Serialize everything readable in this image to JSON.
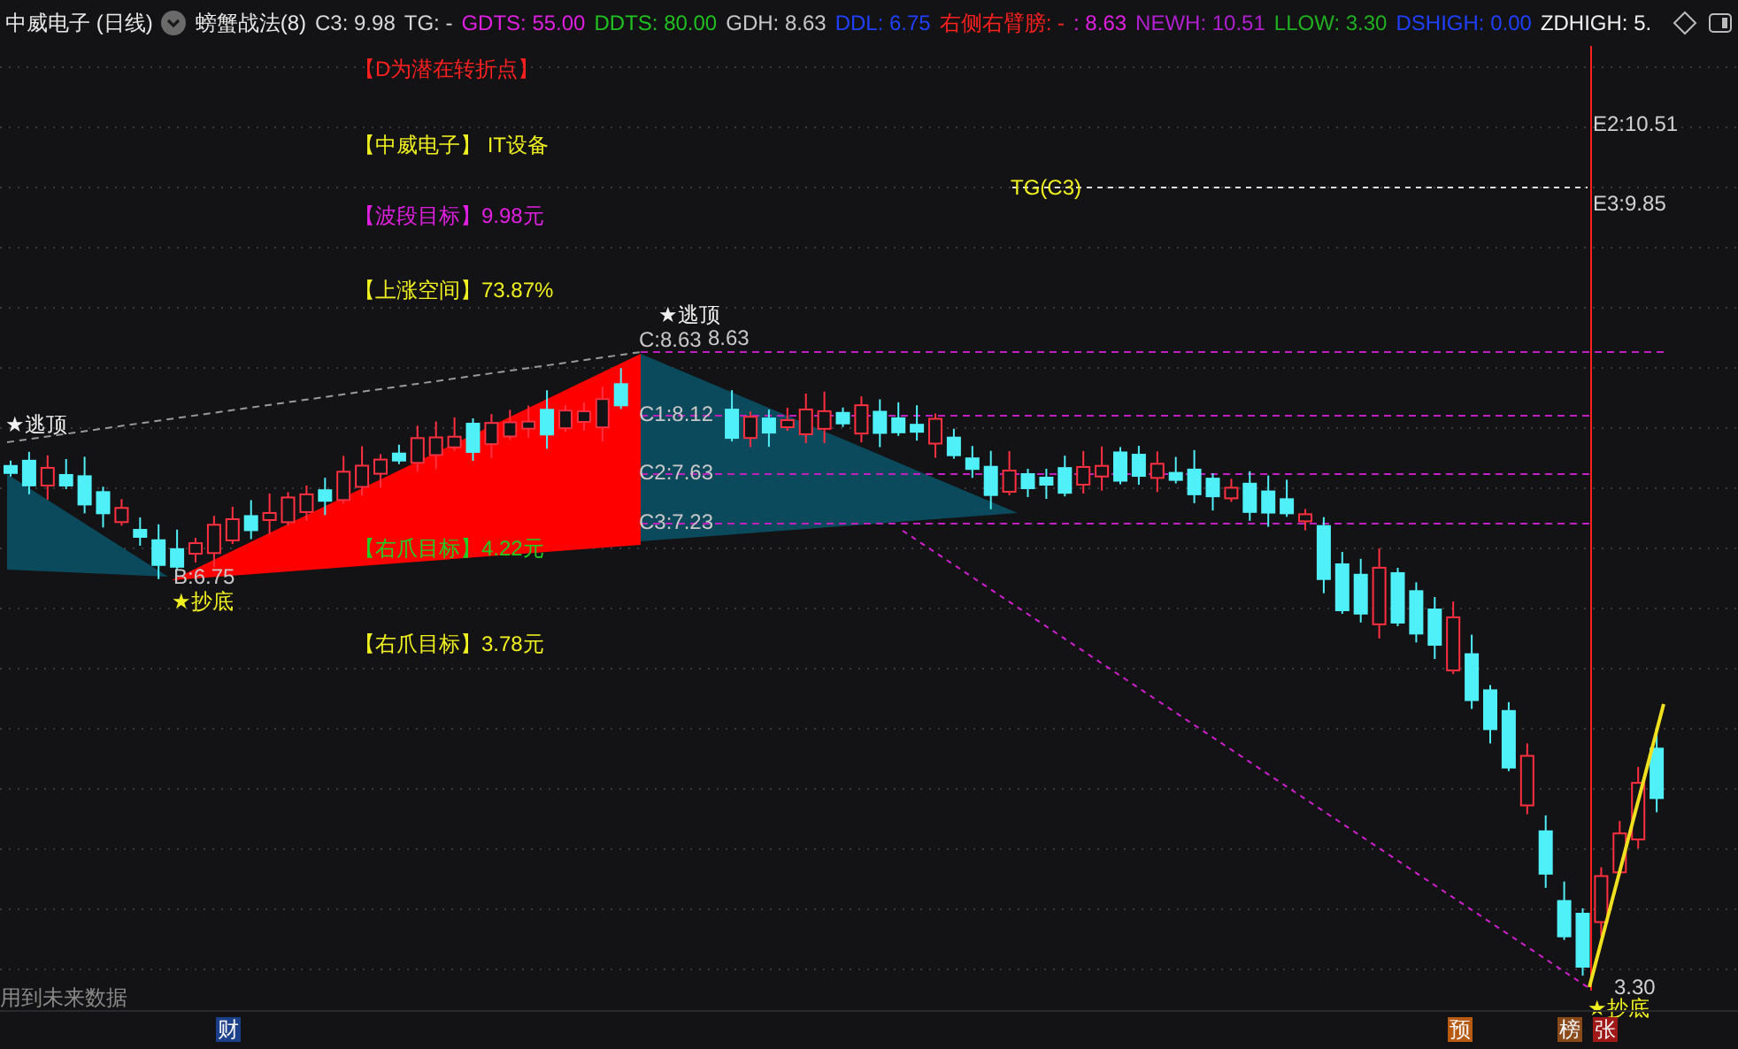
{
  "header": {
    "title": "中威电子 (日线)",
    "indicator": "螃蟹战法(8)",
    "values": [
      {
        "text": "C3: 9.98",
        "color": "#d8d8d8"
      },
      {
        "text": "TG: -",
        "color": "#d8d8d8"
      },
      {
        "text": "GDTS: 55.00",
        "color": "#e020e0"
      },
      {
        "text": "DDTS: 80.00",
        "color": "#20c020"
      },
      {
        "text": "GDH: 8.63",
        "color": "#c8c8c8"
      },
      {
        "text": "DDL: 6.75",
        "color": "#2040ff"
      },
      {
        "text": "右侧右臂膀: -",
        "color": "#ff2020"
      },
      {
        "text": ": 8.63",
        "color": "#e020e0"
      },
      {
        "text": "NEWH: 10.51",
        "color": "#b020d0"
      },
      {
        "text": "LLOW: 3.30",
        "color": "#20b020"
      },
      {
        "text": "DSHIGH: 0.00",
        "color": "#2040ff"
      },
      {
        "text": "ZDHIGH: 5.",
        "color": "#f0f0f0"
      }
    ]
  },
  "chart": {
    "labels": [
      {
        "text": "【D为潜在转折点】",
        "color": "#ff2020"
      },
      {
        "text": "【中威电子】 IT设备",
        "color": "#f0f020"
      },
      {
        "text": "【波段目标】9.98元",
        "color": "#e020e0"
      },
      {
        "text": "【上涨空间】73.87%",
        "color": "#f0f020"
      },
      {
        "text": "TG(C3)",
        "color": "#f0f020"
      },
      {
        "text": "★逃顶",
        "color": "#f0f0f0"
      },
      {
        "text": "★逃顶",
        "color": "#f0f0f0"
      },
      {
        "text": "C:8.63",
        "color": "#c8c8c8"
      },
      {
        "text": "8.63",
        "color": "#c8c8c8"
      },
      {
        "text": "C1:8.12",
        "color": "#c8c8c8"
      },
      {
        "text": "C2:7.63",
        "color": "#c8c8c8"
      },
      {
        "text": "C3:7.23",
        "color": "#c8c8c8"
      },
      {
        "text": "B:6.75",
        "color": "#c8c8c8"
      },
      {
        "text": "★抄底",
        "color": "#f0f020"
      },
      {
        "text": "【右爪目标】4.22元",
        "color": "#20d020"
      },
      {
        "text": "【右爪目标】3.78元",
        "color": "#f0f020"
      },
      {
        "text": "E2:10.51",
        "color": "#d0d0d0"
      },
      {
        "text": "E3:9.85",
        "color": "#d0d0d0"
      },
      {
        "text": "3.30",
        "color": "#d0d0d0"
      },
      {
        "text": "★抄底",
        "color": "#f0f020"
      },
      {
        "text": "用到未来数据",
        "color": "#8a8a8a"
      }
    ]
  },
  "footer": {
    "markers": [
      {
        "text": "财",
        "color": "#1c3f8a"
      },
      {
        "text": "预",
        "color": "#b85a10"
      },
      {
        "text": "榜",
        "color": "#8a4a1a"
      },
      {
        "text": "张",
        "color": "#a01818"
      }
    ]
  }
}
